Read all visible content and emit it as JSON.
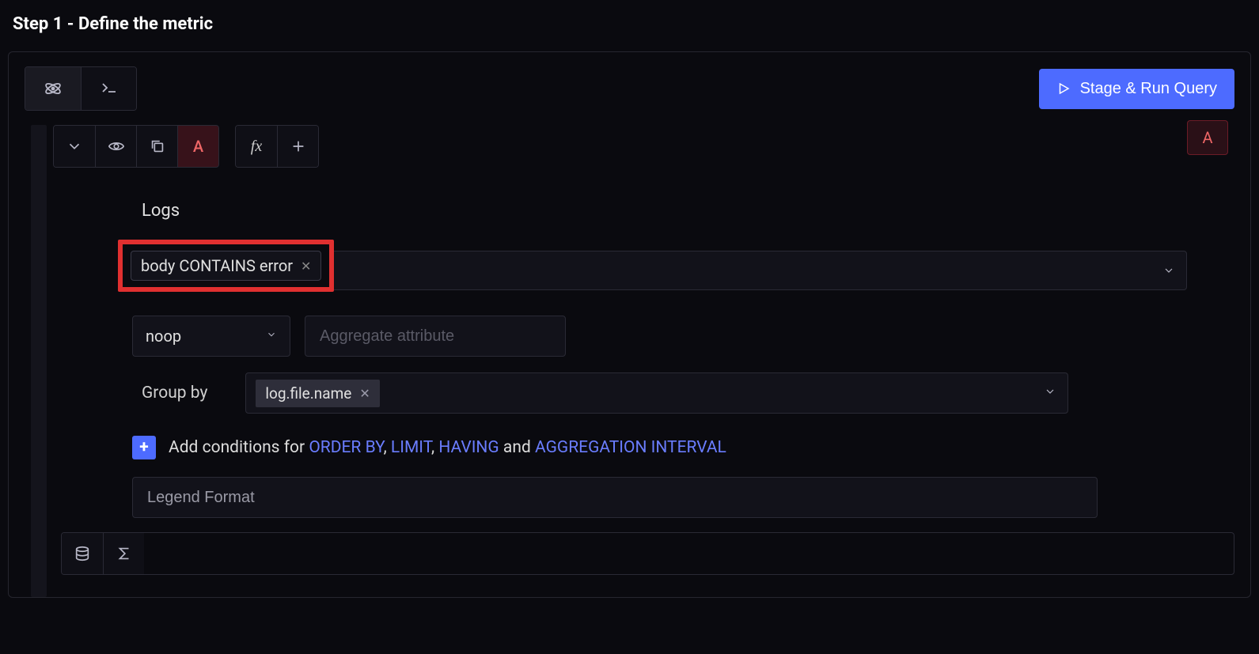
{
  "header": {
    "title": "Step 1 - Define the metric"
  },
  "actions": {
    "run_label": "Stage & Run Query"
  },
  "series": {
    "active_label": "A",
    "badge_label": "A",
    "fx_label": "fx"
  },
  "query": {
    "source_label": "Logs",
    "filter_chip": "body CONTAINS error",
    "aggregate_function": "noop",
    "aggregate_placeholder": "Aggregate attribute",
    "groupby_label": "Group by",
    "groupby_tag": "log.file.name",
    "conditions_prefix": "Add conditions for",
    "kw_order": "ORDER BY",
    "kw_limit": "LIMIT",
    "kw_having": "HAVING",
    "kw_and": "and",
    "kw_aggint": "AGGREGATION INTERVAL",
    "legend_placeholder": "Legend Format"
  }
}
